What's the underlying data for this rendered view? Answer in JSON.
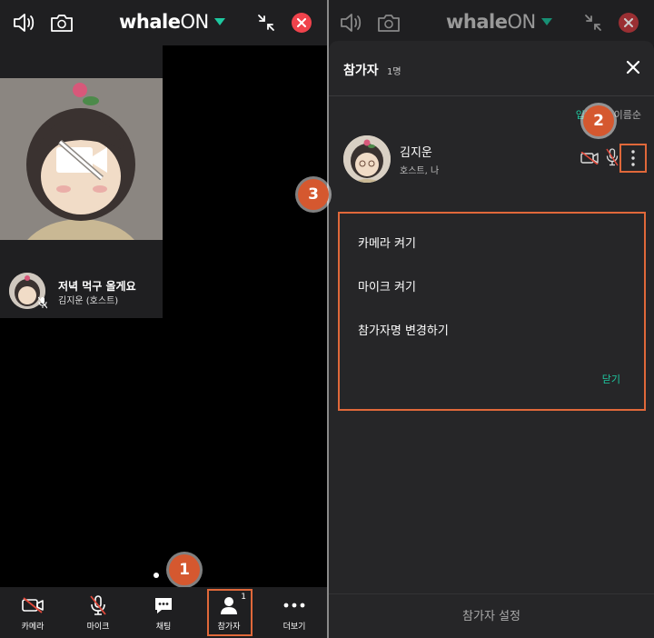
{
  "header": {
    "logo_main": "whale",
    "logo_suffix": "ON"
  },
  "left_screen": {
    "tile": {
      "title": "저녁 먹구 올게요",
      "subtitle": "김지운 (호스트)"
    },
    "bottom_bar": {
      "items": [
        {
          "label": "카메라",
          "icon": "camera-off-icon"
        },
        {
          "label": "마이크",
          "icon": "mic-off-icon"
        },
        {
          "label": "채팅",
          "icon": "chat-icon"
        },
        {
          "label": "참가자",
          "icon": "person-icon",
          "count": "1"
        },
        {
          "label": "더보기",
          "icon": "more-horizontal-icon"
        }
      ]
    }
  },
  "right_screen": {
    "sheet": {
      "title": "참가자",
      "count": "1명",
      "sort": {
        "active": "입장순",
        "inactive": "이름순"
      },
      "participant": {
        "name": "김지운",
        "role": "호스트, 나"
      },
      "menu": {
        "items": [
          "카메라 켜기",
          "마이크 켜기",
          "참가자명 변경하기"
        ],
        "close_label": "닫기"
      },
      "footer": "참가자 설정"
    }
  },
  "annotations": [
    "1",
    "2",
    "3"
  ],
  "colors": {
    "accent": "#1ec8a0",
    "highlight": "#e0683a",
    "close_red": "#f0434c",
    "badge": "#d5582f"
  }
}
